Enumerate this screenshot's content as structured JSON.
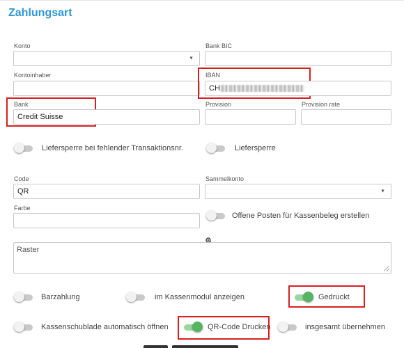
{
  "section": {
    "title": "Zahlungsart"
  },
  "fields": {
    "konto": {
      "label": "Konto",
      "value": ""
    },
    "bank_bic": {
      "label": "Bank BIC",
      "value": ""
    },
    "kontoinhaber": {
      "label": "Kontoinhaber",
      "value": ""
    },
    "iban": {
      "label": "IBAN",
      "value": "CH"
    },
    "bank": {
      "label": "Bank",
      "value": "Credit Suisse"
    },
    "provision": {
      "label": "Provision",
      "value": ""
    },
    "provision_rate": {
      "label": "Provision rate",
      "value": ""
    },
    "code": {
      "label": "Code",
      "value": "QR"
    },
    "sammelkonto": {
      "label": "Sammelkonto",
      "value": ""
    },
    "farbe": {
      "label": "Farbe",
      "value": ""
    },
    "raster": {
      "placeholder": "Raster"
    }
  },
  "toggles": {
    "liefersperre_transaktion": {
      "label": "Liefersperre bei fehlender Transaktionsnr.",
      "on": false
    },
    "liefersperre": {
      "label": "Liefersperre",
      "on": false
    },
    "offene_posten": {
      "label": "Offene Posten für Kassenbeleg erstellen",
      "on": false
    },
    "barzahlung": {
      "label": "Barzahlung",
      "on": false
    },
    "kassenmodul": {
      "label": "im Kassenmodul anzeigen",
      "on": false
    },
    "gedruckt": {
      "label": "Gedruckt",
      "on": true
    },
    "kassenschublade": {
      "label": "Kassenschublade automatisch öffnen",
      "on": false
    },
    "qr_code_drucken": {
      "label": "QR-Code Drucken",
      "on": true
    },
    "insgesamt": {
      "label": "insgesamt übernehmen",
      "on": false
    }
  },
  "icons": {
    "cursor": "zoom-cursor-icon",
    "dropdown": "caret-down-icon",
    "resize": "resize-handle-icon"
  },
  "colors": {
    "accent": "#2f97d8",
    "highlight": "#d62020",
    "toggle_on": "#55b560"
  }
}
